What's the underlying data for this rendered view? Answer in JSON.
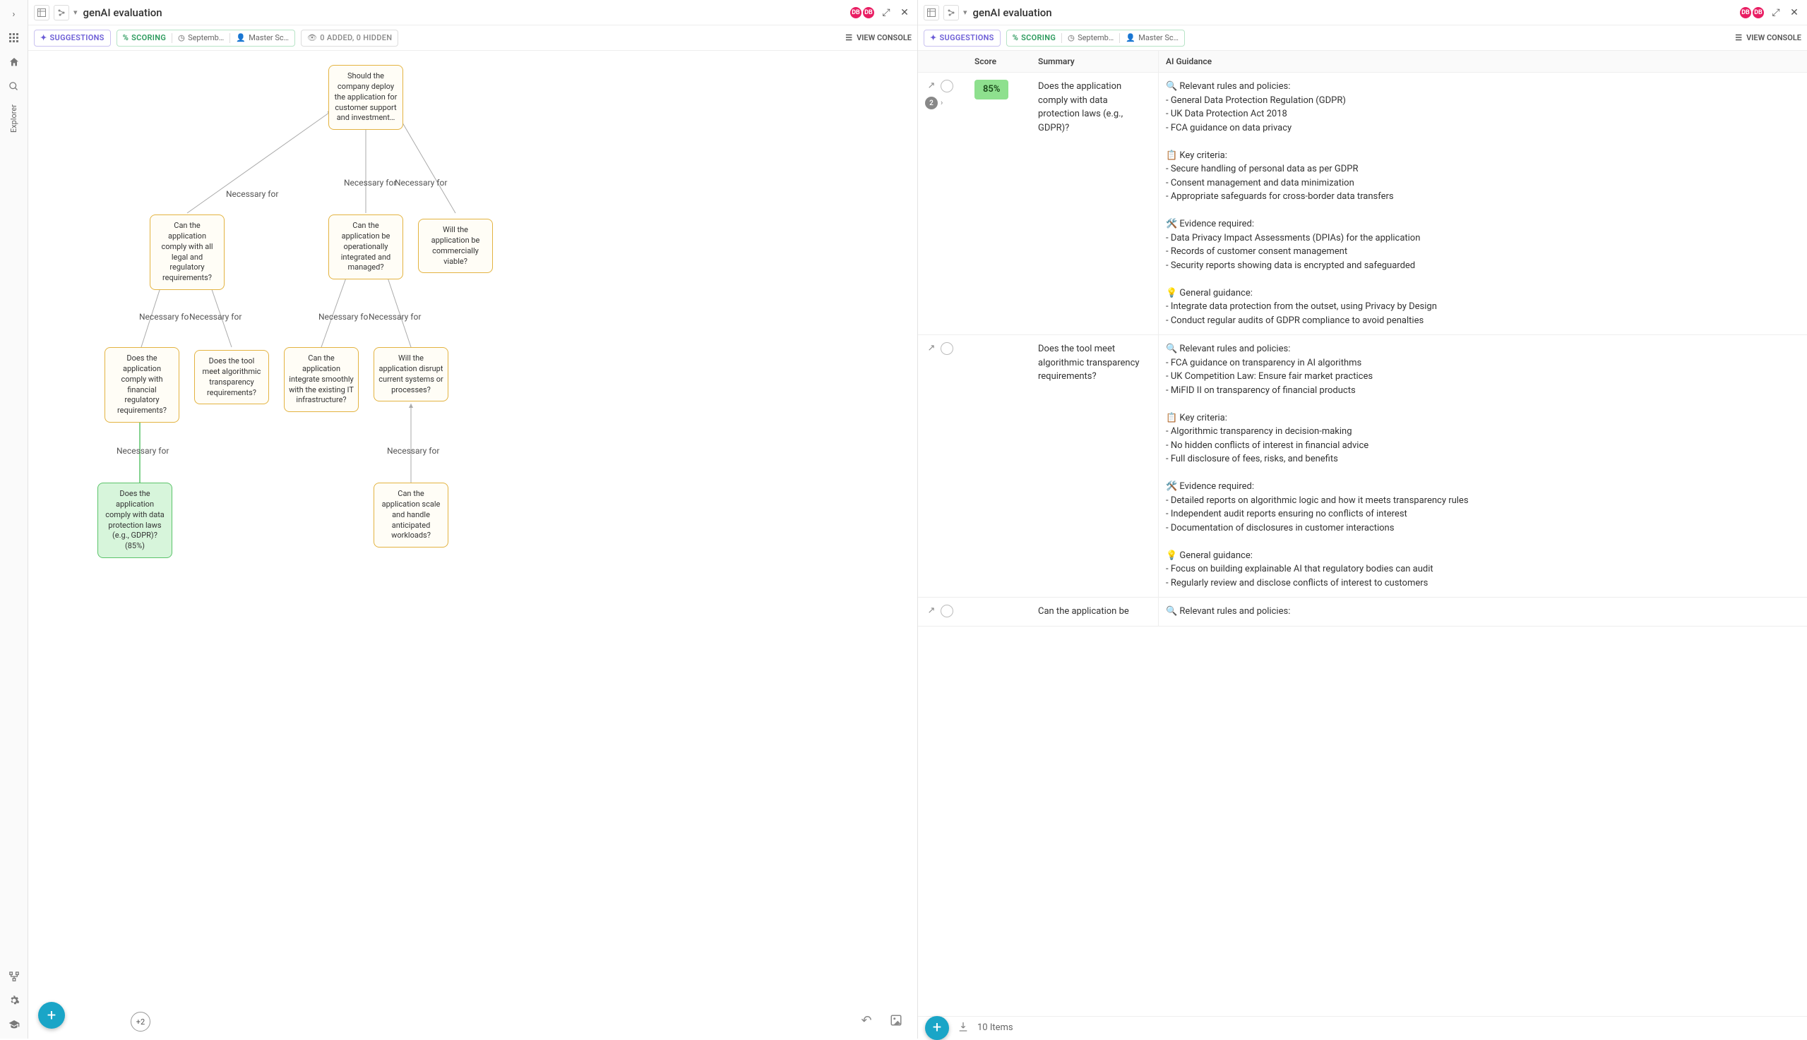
{
  "rail": {
    "explorer_label": "Explorer"
  },
  "header": {
    "title": "genAI evaluation",
    "avatar_initials": "DB"
  },
  "toolbar": {
    "suggestions_label": "SUGGESTIONS",
    "scoring_label": "SCORING",
    "scoring_date": "Septemb…",
    "scoring_author": "Master Sc…",
    "counts_label": "0 ADDED, 0 HIDDEN",
    "view_console": "VIEW CONSOLE"
  },
  "graph": {
    "nodes": {
      "root": "Should the company deploy the application for customer support and investment…",
      "legal": "Can the application comply with all legal and regulatory requirements?",
      "ops": "Can the application be operationally integrated and managed?",
      "viable": "Will the application be commercially viable?",
      "finreg": "Does the application comply with financial regulatory requirements?",
      "transp": "Does the tool meet algorithmic transparency requirements?",
      "it": "Can the application integrate smoothly with the existing IT infrastructure?",
      "disrupt": "Will the application disrupt current systems or processes?",
      "gdpr": "Does the application comply with data protection laws (e.g., GDPR)? (85%)",
      "scale": "Can the application scale and handle anticipated workloads?"
    },
    "edge_label": "Necessary for",
    "edge_label_trunc": "Necessary fo",
    "more": "+2"
  },
  "table": {
    "headers": {
      "score": "Score",
      "summary": "Summary",
      "guidance": "AI Guidance"
    },
    "footer_count": "10 Items",
    "rows": [
      {
        "score": "85%",
        "actions_count": "2",
        "summary": "Does the application comply with data protection laws (e.g., GDPR)?",
        "guidance": "🔍 Relevant rules and policies:\n- General Data Protection Regulation (GDPR)\n- UK Data Protection Act 2018\n- FCA guidance on data privacy\n\n📋 Key criteria:\n- Secure handling of personal data as per GDPR\n- Consent management and data minimization\n- Appropriate safeguards for cross-border data transfers\n\n🛠️ Evidence required:\n- Data Privacy Impact Assessments (DPIAs) for the application\n- Records of customer consent management\n- Security reports showing data is encrypted and safeguarded\n\n💡 General guidance:\n- Integrate data protection from the outset, using Privacy by Design\n- Conduct regular audits of GDPR compliance to avoid penalties"
      },
      {
        "score": "",
        "actions_count": "",
        "summary": "Does the tool meet algorithmic transparency requirements?",
        "guidance": "🔍 Relevant rules and policies:\n- FCA guidance on transparency in AI algorithms\n- UK Competition Law: Ensure fair market practices\n- MiFID II on transparency of financial products\n\n📋 Key criteria:\n- Algorithmic transparency in decision-making\n- No hidden conflicts of interest in financial advice\n- Full disclosure of fees, risks, and benefits\n\n🛠️ Evidence required:\n- Detailed reports on algorithmic logic and how it meets transparency rules\n- Independent audit reports ensuring no conflicts of interest\n- Documentation of disclosures in customer interactions\n\n💡 General guidance:\n- Focus on building explainable AI that regulatory bodies can audit\n- Regularly review and disclose conflicts of interest to customers"
      },
      {
        "score": "",
        "actions_count": "",
        "summary": "Can the application be",
        "guidance": "🔍 Relevant rules and policies:"
      }
    ]
  }
}
